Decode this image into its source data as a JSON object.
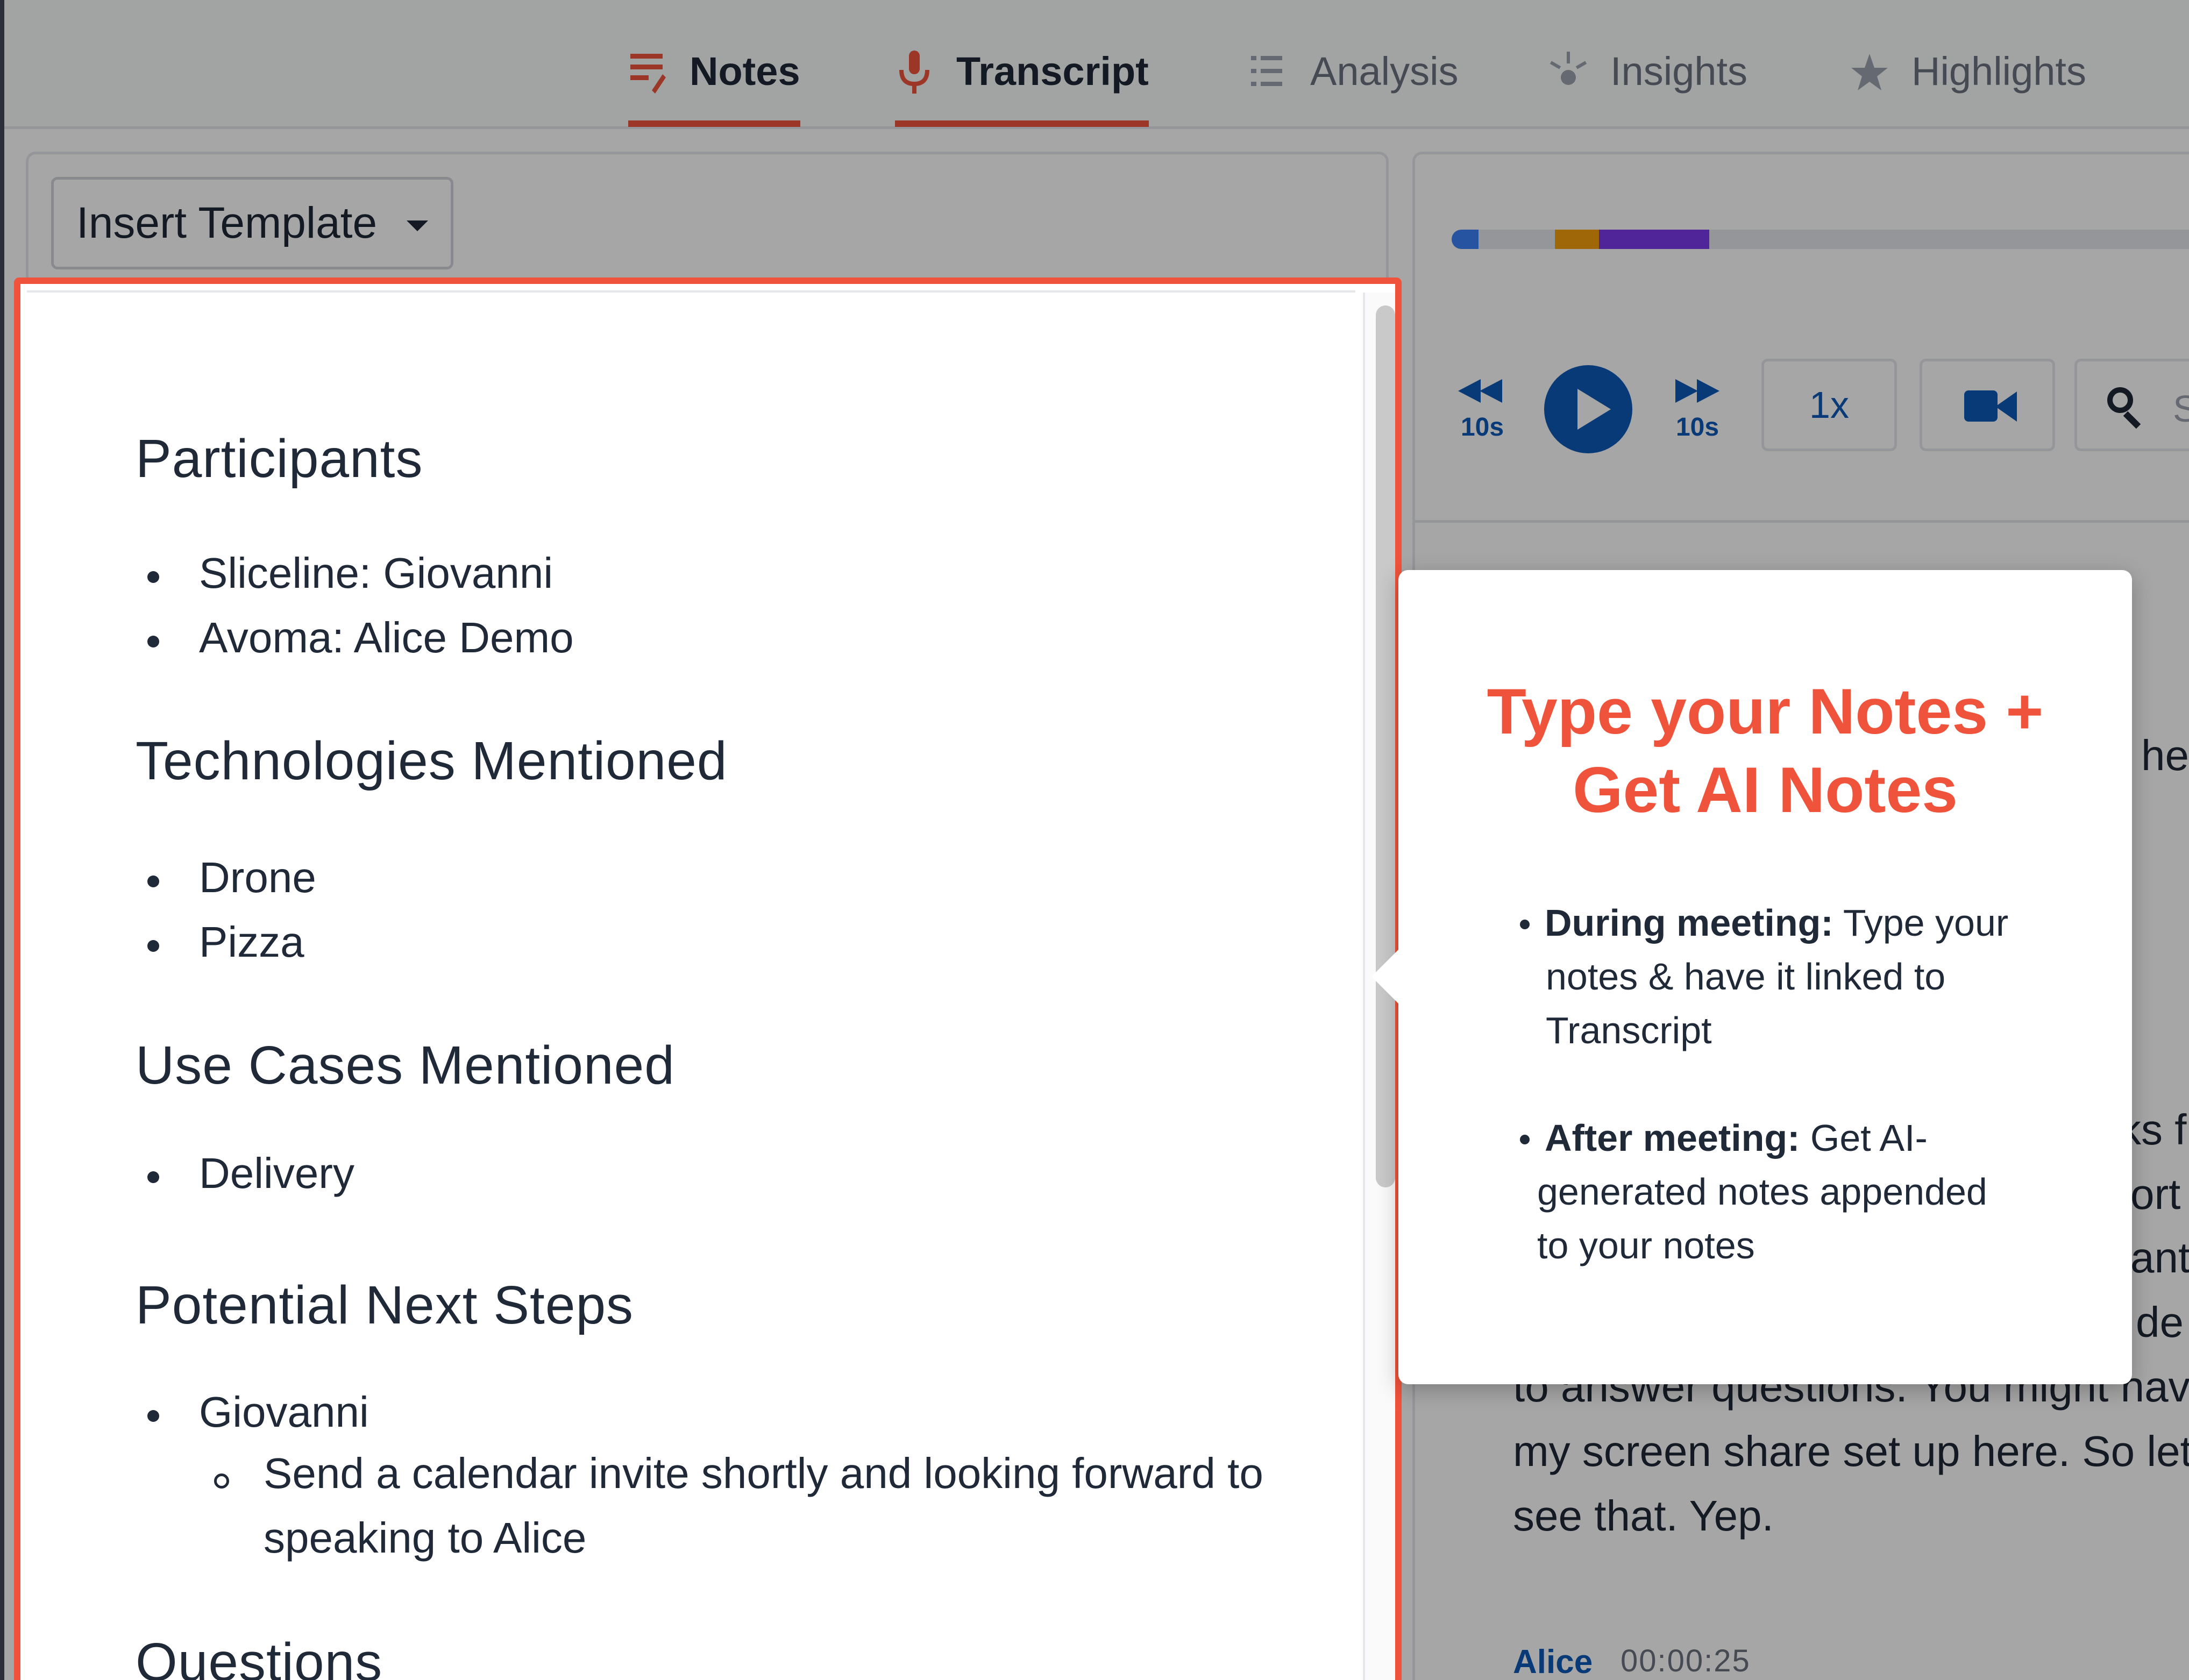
{
  "tabs": [
    {
      "label": "Notes",
      "icon": "notes-icon",
      "active": true
    },
    {
      "label": "Transcript",
      "icon": "microphone-icon",
      "active": true
    },
    {
      "label": "Analysis",
      "icon": "analysis-icon",
      "active": false
    },
    {
      "label": "Insights",
      "icon": "insights-icon",
      "active": false
    },
    {
      "label": "Highlights",
      "icon": "star-icon",
      "active": false
    }
  ],
  "notes": {
    "insert_template_label": "Insert Template",
    "sections": [
      {
        "heading": "Participants",
        "items": [
          "Sliceline: Giovanni",
          "Avoma: Alice Demo"
        ]
      },
      {
        "heading": "Technologies Mentioned",
        "items": [
          "Drone",
          "Pizza"
        ]
      },
      {
        "heading": "Use Cases Mentioned",
        "items": [
          "Delivery"
        ]
      },
      {
        "heading": "Potential Next Steps",
        "items": [
          "Giovanni"
        ],
        "subitems": [
          "Send a calendar invite shortly and looking forward to speaking to Alice"
        ]
      },
      {
        "heading": "Questions",
        "items": []
      }
    ]
  },
  "player": {
    "progress_segments": [
      {
        "color": "#3b82f6",
        "start": 0.0,
        "end": 0.036
      },
      {
        "color": "#f59e0b",
        "start": 0.137,
        "end": 0.196
      },
      {
        "color": "#7c3aed",
        "start": 0.196,
        "end": 0.342
      }
    ],
    "rewind_label": "10s",
    "forward_label": "10s",
    "speed_label": "1x",
    "search_placeholder": "S",
    "transcript_fragments": [
      "he",
      "ks f",
      "ort",
      "ant",
      "de",
      "to answer questions. You might have",
      "my screen share set up here. So let m",
      "see that. Yep."
    ],
    "speaker": "Alice",
    "timestamp": "00:00:25"
  },
  "tooltip": {
    "title_line1": "Type your Notes +",
    "title_line2": "Get AI Notes",
    "b1_bold": "During meeting:",
    "b1_l1": " Type your",
    "b1_l2": "notes & have it linked to",
    "b1_l3": "Transcript",
    "b2_bold": "After meeting:",
    "b2_l1": " Get AI-",
    "b2_l2": "generated notes appended",
    "b2_l3": "to your notes"
  },
  "colors": {
    "accent": "#f0533b",
    "brand_blue": "#0f5ab8"
  }
}
